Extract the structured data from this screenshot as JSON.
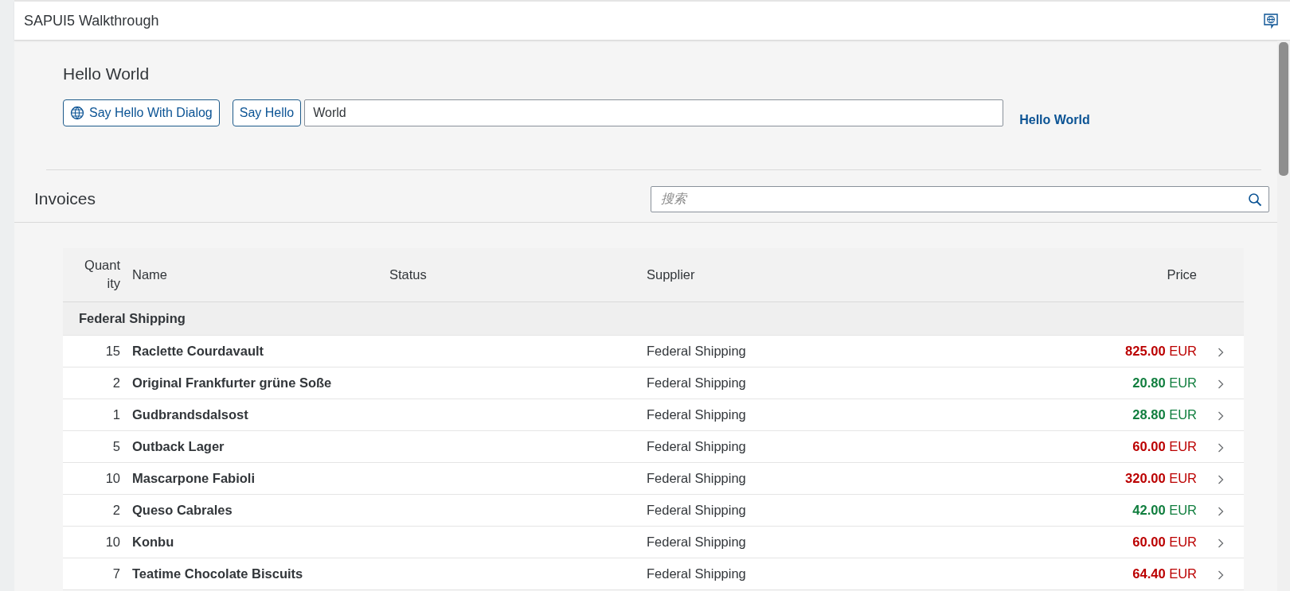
{
  "shell": {
    "title": "SAPUI5 Walkthrough"
  },
  "panel": {
    "title": "Hello World",
    "dialog_button": "Say Hello With Dialog",
    "hello_button": "Say Hello",
    "name_input": "World",
    "greeting": "Hello World"
  },
  "invoices": {
    "title": "Invoices",
    "search": {
      "placeholder": "搜索"
    },
    "columns": [
      "Quantity",
      "Name",
      "Status",
      "Supplier",
      "Price"
    ],
    "groups": [
      {
        "title": "Federal Shipping",
        "rows": [
          {
            "quantity": "15",
            "name": "Raclette Courdavault",
            "supplier": "Federal Shipping",
            "amount": "825.00",
            "currency": "EUR",
            "color": "#bb0000"
          },
          {
            "quantity": "2",
            "name": "Original Frankfurter grüne Soße",
            "supplier": "Federal Shipping",
            "amount": "20.80",
            "currency": "EUR",
            "color": "#107e3e"
          },
          {
            "quantity": "1",
            "name": "Gudbrandsdalsost",
            "supplier": "Federal Shipping",
            "amount": "28.80",
            "currency": "EUR",
            "color": "#107e3e"
          },
          {
            "quantity": "5",
            "name": "Outback Lager",
            "supplier": "Federal Shipping",
            "amount": "60.00",
            "currency": "EUR",
            "color": "#bb0000"
          },
          {
            "quantity": "10",
            "name": "Mascarpone Fabioli",
            "supplier": "Federal Shipping",
            "amount": "320.00",
            "currency": "EUR",
            "color": "#bb0000"
          },
          {
            "quantity": "2",
            "name": "Queso Cabrales",
            "supplier": "Federal Shipping",
            "amount": "42.00",
            "currency": "EUR",
            "color": "#107e3e"
          },
          {
            "quantity": "10",
            "name": "Konbu",
            "supplier": "Federal Shipping",
            "amount": "60.00",
            "currency": "EUR",
            "color": "#bb0000"
          },
          {
            "quantity": "7",
            "name": "Teatime Chocolate Biscuits",
            "supplier": "Federal Shipping",
            "amount": "64.40",
            "currency": "EUR",
            "color": "#bb0000"
          }
        ]
      }
    ]
  }
}
